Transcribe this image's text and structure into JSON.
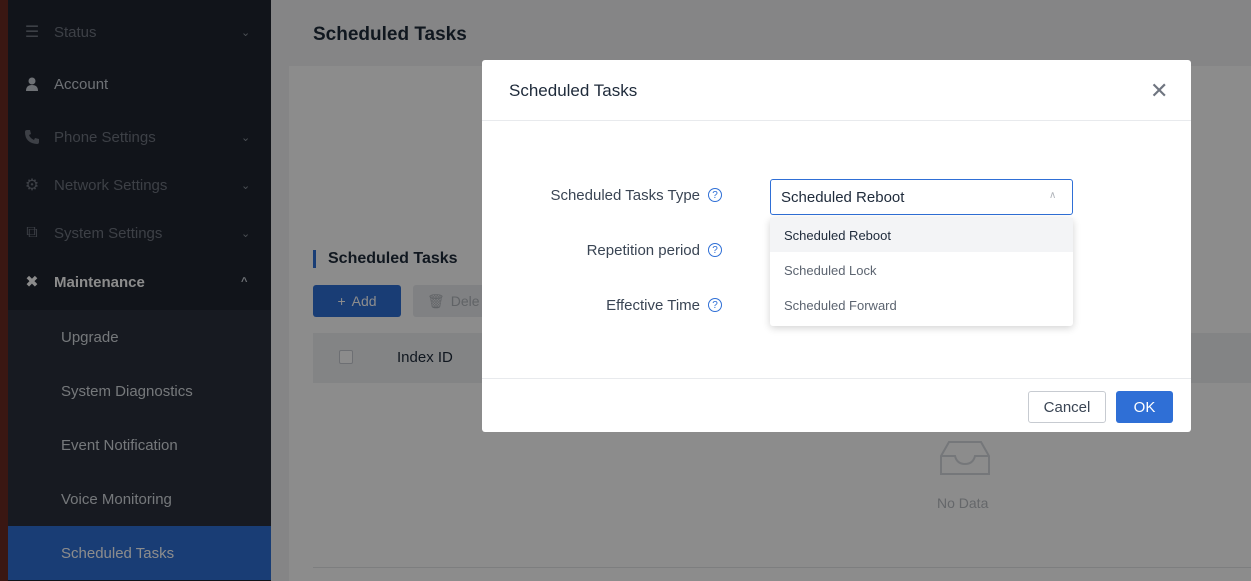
{
  "sidebar": {
    "items": [
      {
        "label": "Status",
        "icon": "list-icon"
      },
      {
        "label": "Account",
        "icon": "user-icon"
      },
      {
        "label": "Phone Settings",
        "icon": "phone-icon"
      },
      {
        "label": "Network Settings",
        "icon": "network-icon"
      },
      {
        "label": "System Settings",
        "icon": "system-icon"
      },
      {
        "label": "Maintenance",
        "icon": "tools-icon"
      }
    ],
    "sub_items": [
      {
        "label": "Upgrade"
      },
      {
        "label": "System Diagnostics"
      },
      {
        "label": "Event Notification"
      },
      {
        "label": "Voice Monitoring"
      },
      {
        "label": "Scheduled Tasks"
      }
    ]
  },
  "main": {
    "title": "Scheduled Tasks",
    "section_title": "Scheduled Tasks",
    "add_label": "Add",
    "delete_label": "Dele",
    "table": {
      "columns": [
        "Index ID"
      ]
    },
    "empty_text": "No Data"
  },
  "modal": {
    "title": "Scheduled Tasks",
    "fields": [
      {
        "label": "Scheduled Tasks Type"
      },
      {
        "label": "Repetition period"
      },
      {
        "label": "Effective Time"
      }
    ],
    "select_value": "Scheduled Reboot",
    "options": [
      "Scheduled Reboot",
      "Scheduled Lock",
      "Scheduled Forward"
    ],
    "cancel_label": "Cancel",
    "ok_label": "OK"
  },
  "colors": {
    "accent": "#2f6fd6",
    "sidebar_bg": "#1f2530",
    "active_item": "#2f6fd6"
  }
}
